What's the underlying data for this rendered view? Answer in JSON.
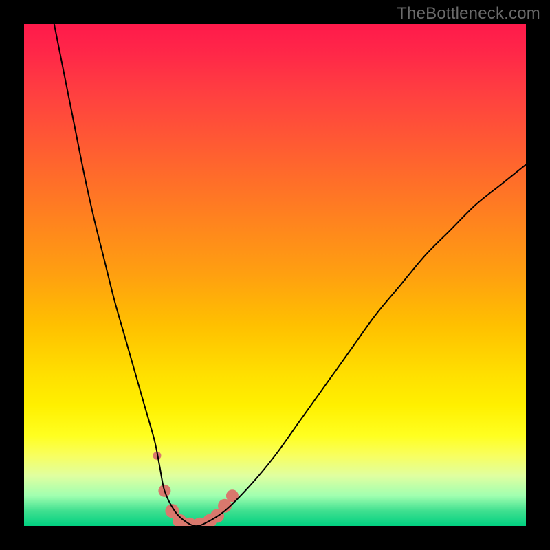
{
  "watermark": "TheBottleneck.com",
  "chart_data": {
    "type": "line",
    "title": "",
    "xlabel": "",
    "ylabel": "",
    "xlim": [
      0,
      100
    ],
    "ylim": [
      0,
      100
    ],
    "grid": false,
    "legend": false,
    "background": {
      "type": "vertical-gradient",
      "stops": [
        {
          "pos": 0,
          "color": "#ff1a4b"
        },
        {
          "pos": 50,
          "color": "#ffa010"
        },
        {
          "pos": 82,
          "color": "#ffff20"
        },
        {
          "pos": 100,
          "color": "#00d080"
        }
      ]
    },
    "series": [
      {
        "name": "bottleneck-curve",
        "stroke": "#000000",
        "stroke_width": 2,
        "x": [
          6,
          8,
          10,
          12,
          14,
          16,
          18,
          20,
          22,
          24,
          26,
          27,
          28,
          30,
          32,
          34,
          36,
          40,
          45,
          50,
          55,
          60,
          65,
          70,
          75,
          80,
          85,
          90,
          95,
          100
        ],
        "y": [
          100,
          90,
          80,
          70,
          61,
          53,
          45,
          38,
          31,
          24,
          17,
          12,
          7,
          3,
          1,
          0,
          0.5,
          3,
          8,
          14,
          21,
          28,
          35,
          42,
          48,
          54,
          59,
          64,
          68,
          72
        ]
      }
    ],
    "markers": {
      "name": "highlight-band",
      "color": "#d9786d",
      "points": [
        {
          "x": 26.5,
          "y": 14,
          "r": 6
        },
        {
          "x": 28.0,
          "y": 7,
          "r": 9
        },
        {
          "x": 29.5,
          "y": 3,
          "r": 10
        },
        {
          "x": 31.0,
          "y": 1,
          "r": 10
        },
        {
          "x": 33.0,
          "y": 0.3,
          "r": 10
        },
        {
          "x": 35.0,
          "y": 0.3,
          "r": 10
        },
        {
          "x": 37.0,
          "y": 1,
          "r": 10
        },
        {
          "x": 38.5,
          "y": 2,
          "r": 10
        },
        {
          "x": 40.0,
          "y": 4,
          "r": 10
        },
        {
          "x": 41.5,
          "y": 6,
          "r": 9
        }
      ]
    }
  }
}
